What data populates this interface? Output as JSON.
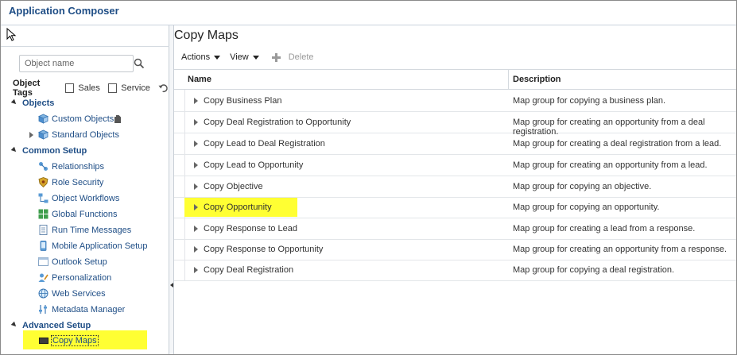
{
  "app": {
    "title": "Application Composer"
  },
  "sidebar": {
    "search": {
      "placeholder": "Object name"
    },
    "tags": {
      "label": "Object Tags",
      "options": [
        "Sales",
        "Service"
      ]
    },
    "sections": [
      {
        "label": "Objects",
        "items": [
          "Custom Objects",
          "Standard Objects"
        ]
      },
      {
        "label": "Common Setup",
        "items": [
          "Relationships",
          "Role Security",
          "Object Workflows",
          "Global Functions",
          "Run Time Messages",
          "Mobile Application Setup",
          "Outlook Setup",
          "Personalization",
          "Web Services",
          "Metadata Manager"
        ]
      },
      {
        "label": "Advanced Setup",
        "items": [
          "Copy Maps"
        ]
      }
    ]
  },
  "main": {
    "title": "Copy Maps",
    "toolbar": {
      "actions": "Actions",
      "view": "View",
      "delete": "Delete"
    },
    "columns": {
      "name": "Name",
      "description": "Description"
    },
    "rows": [
      {
        "name": "Copy Business Plan",
        "description": "Map group for copying a business plan."
      },
      {
        "name": "Copy Deal Registration to Opportunity",
        "description": "Map group for creating an opportunity from a deal registration."
      },
      {
        "name": "Copy Lead to Deal Registration",
        "description": "Map group for creating a deal registration from a lead."
      },
      {
        "name": "Copy Lead to Opportunity",
        "description": "Map group for creating an opportunity from a lead."
      },
      {
        "name": "Copy Objective",
        "description": "Map group for copying an objective."
      },
      {
        "name": "Copy Opportunity",
        "description": "Map group for copying an opportunity."
      },
      {
        "name": "Copy Response to Lead",
        "description": "Map group for creating a lead from a response."
      },
      {
        "name": "Copy Response to Opportunity",
        "description": "Map group for creating an opportunity from a response."
      },
      {
        "name": "Copy Deal Registration",
        "description": "Map group for copying a deal registration."
      }
    ]
  },
  "colors": {
    "link": "#1f4e86",
    "highlight": "#ffff33"
  }
}
